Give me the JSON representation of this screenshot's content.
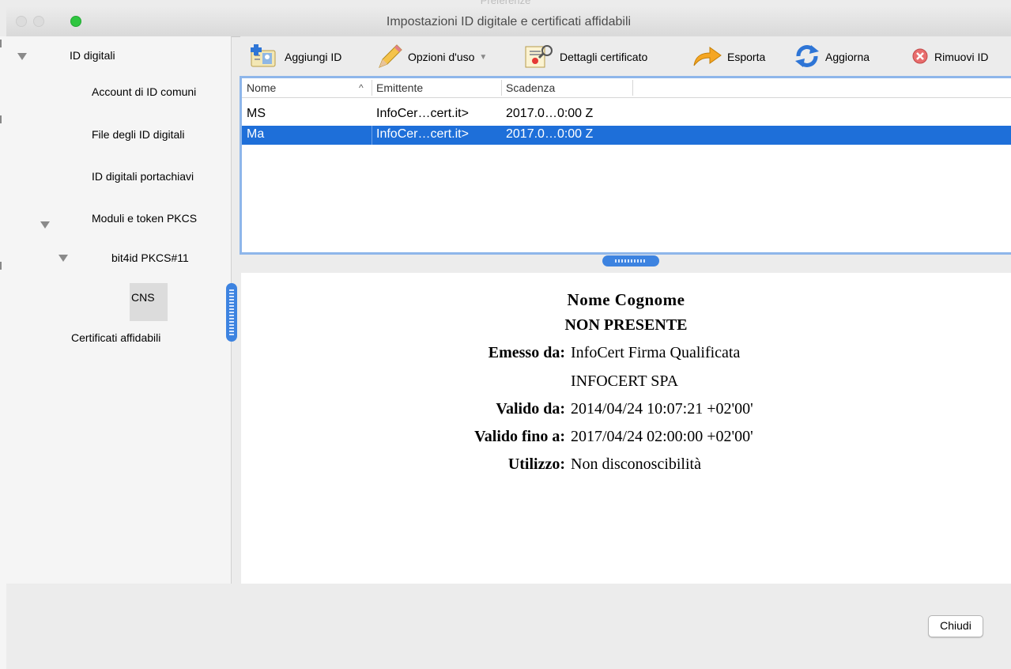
{
  "window": {
    "ghost_title": "Preferenze",
    "title": "Impostazioni ID digitale e certificati affidabili"
  },
  "sidebar": {
    "items": [
      {
        "label": "ID digitali",
        "expanded": true
      },
      {
        "label": "Account di ID comuni"
      },
      {
        "label": "File degli ID digitali"
      },
      {
        "label": "ID digitali portachiavi"
      },
      {
        "label": "Moduli e token PKCS",
        "expanded": true
      },
      {
        "label": "bit4id PKCS#11",
        "expanded": true
      },
      {
        "label": "CNS",
        "selected": true
      },
      {
        "label": "Certificati affidabili"
      }
    ]
  },
  "toolbar": {
    "add_id": "Aggiungi ID",
    "usage_options": "Opzioni d'uso",
    "certificate_details": "Dettagli certificato",
    "export": "Esporta",
    "refresh": "Aggiorna",
    "remove_id": "Rimuovi ID"
  },
  "table": {
    "columns": [
      "Nome",
      "Emittente",
      "Scadenza"
    ],
    "rows": [
      {
        "name": "MS",
        "issuer": "InfoCer…cert.it>",
        "expiry": "2017.0…0:00 Z",
        "selected": false
      },
      {
        "name": "Ma",
        "issuer": "InfoCer…cert.it>",
        "expiry": "2017.0…0:00 Z",
        "selected": true
      }
    ]
  },
  "details": {
    "name": "Nome Cognome",
    "org": "NON PRESENTE",
    "issued_by_key": "Emesso da:",
    "issued_by_value": "InfoCert Firma Qualificata",
    "issued_by_org": "INFOCERT SPA",
    "valid_from_key": "Valido da:",
    "valid_from_value": "2014/04/24 10:07:21 +02'00'",
    "valid_to_key": "Valido fino a:",
    "valid_to_value": "2017/04/24 02:00:00 +02'00'",
    "usage_key": "Utilizzo:",
    "usage_value": "Non disconoscibilità"
  },
  "footer": {
    "close_button": "Chiudi"
  },
  "colors": {
    "selection": "#1e6fd9",
    "focus_ring": "#8eb6ea",
    "splitter": "#3d83e0",
    "zoom_button": "#2fc640"
  }
}
